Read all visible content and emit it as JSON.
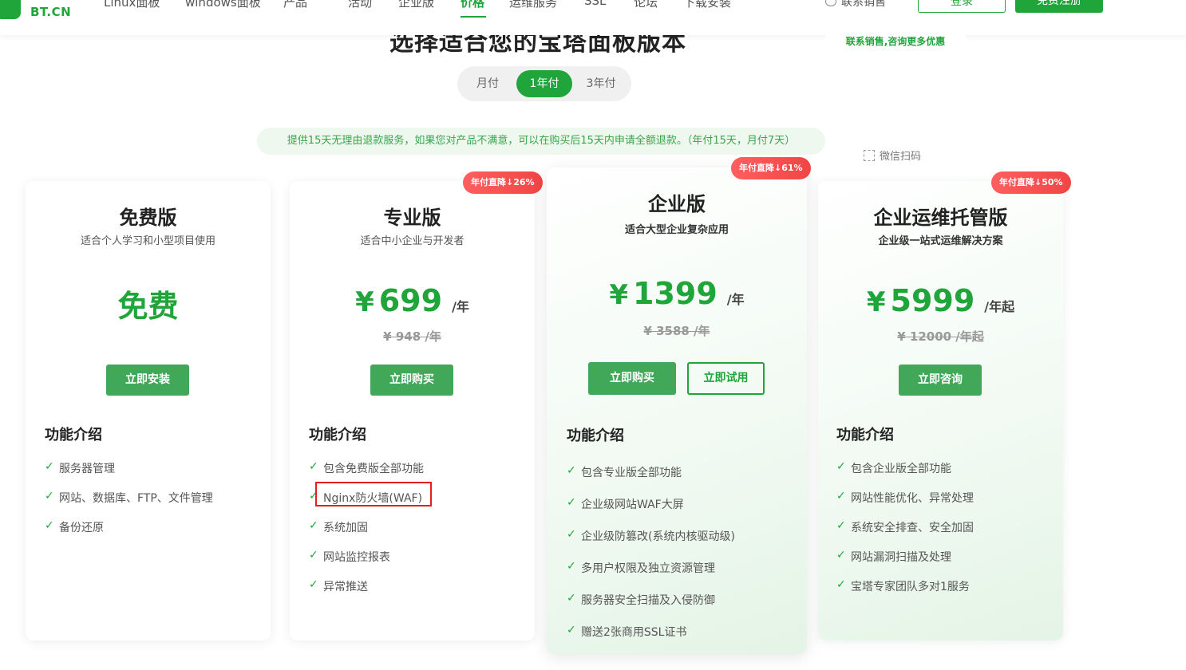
{
  "nav": {
    "logo_text": "BT.CN",
    "items": [
      "Linux面板",
      "windows面板",
      "产品",
      "活动",
      "企业版",
      "价格",
      "运维服务",
      "SSL",
      "论坛",
      "下载安装"
    ],
    "active_index": 5,
    "contact_label": "联系销售",
    "login_label": "登录",
    "register_label": "免费注册"
  },
  "page_title": "选择适合您的宝塔面板版本",
  "sales_popup_text": "联系销售,咨询更多优惠",
  "period": {
    "options": [
      "月付",
      "1年付",
      "3年付"
    ],
    "selected": "1年付"
  },
  "refund_notice": "提供15天无理由退款服务，如果您对产品不满意，可以在购买后15天内申请全额退款。（年付15天，月付7天）",
  "wechat_label": "微信扫码",
  "plans": [
    {
      "title": "免费版",
      "subtitle": "适合个人学习和小型项目使用",
      "price_text": "免费",
      "buttons": [
        "立即安装"
      ],
      "features_title": "功能介绍",
      "features": [
        "服务器管理",
        "网站、数据库、FTP、文件管理",
        "备份还原"
      ]
    },
    {
      "title": "专业版",
      "badge": "年付直降↓26%",
      "subtitle": "适合中小企业与开发者",
      "currency": "¥",
      "price": "699",
      "unit": "/年",
      "original_price": "¥ 948 /年",
      "buttons": [
        "立即购买"
      ],
      "features_title": "功能介绍",
      "features": [
        "包含免费版全部功能",
        "Nginx防火墙(WAF)",
        "系统加固",
        "网站监控报表",
        "异常推送"
      ],
      "highlighted_feature_index": 1
    },
    {
      "title": "企业版",
      "badge": "年付直降↓61%",
      "subtitle": "适合大型企业复杂应用",
      "currency": "¥",
      "price": "1399",
      "unit": "/年",
      "original_price": "¥ 3588 /年",
      "buttons": [
        "立即购买",
        "立即试用"
      ],
      "features_title": "功能介绍",
      "features": [
        "包含专业版全部功能",
        "企业级网站WAF大屏",
        "企业级防篡改(系统内核驱动级)",
        "多用户权限及独立资源管理",
        "服务器安全扫描及入侵防御",
        "赠送2张商用SSL证书"
      ]
    },
    {
      "title": "企业运维托管版",
      "badge": "年付直降↓50%",
      "subtitle": "企业级一站式运维解决方案",
      "currency": "¥",
      "price": "5999",
      "unit": "/年起",
      "original_price": "¥ 12000 /年起",
      "buttons": [
        "立即咨询"
      ],
      "features_title": "功能介绍",
      "features": [
        "包含企业版全部功能",
        "网站性能优化、异常处理",
        "系统安全排查、安全加固",
        "网站漏洞扫描及处理",
        "宝塔专家团队多对1服务"
      ]
    }
  ],
  "colors": {
    "brand_green": "#20a53a",
    "button_green": "#41a85a",
    "badge_red": "#f04545",
    "highlight_red": "#e02020"
  }
}
